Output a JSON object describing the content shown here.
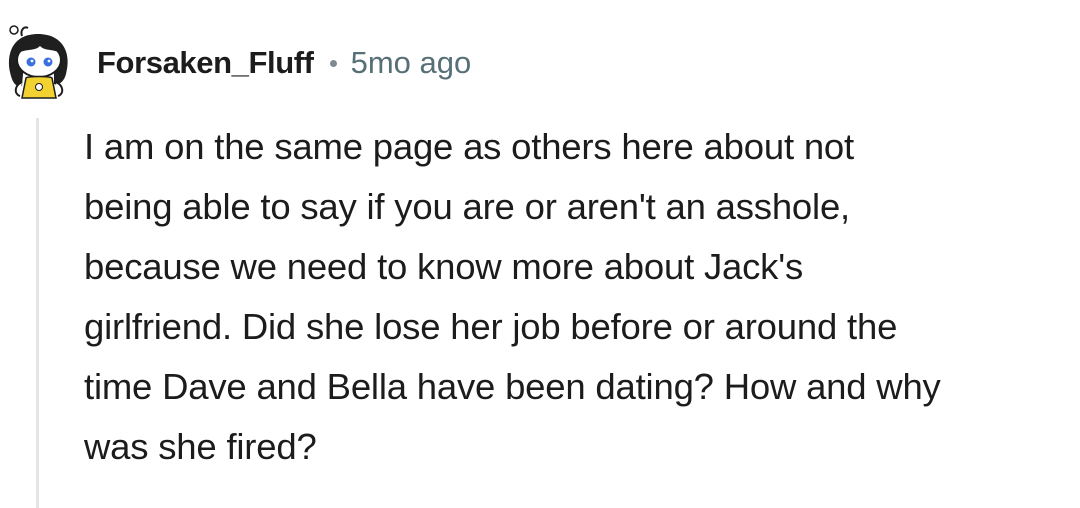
{
  "comment": {
    "username": "Forsaken_Fluff",
    "timestamp": "5mo ago",
    "avatar_icon": "snoo-avatar-icon",
    "body_lines": [
      "I am on the same page as others here about not",
      "being able to say if you are or aren't an asshole,",
      "because we need to know more about Jack's",
      "girlfriend. Did she lose her job before or around the",
      "time Dave and Bella have been dating? How and why",
      "was she fired?"
    ]
  },
  "colors": {
    "text": "#1c1c1c",
    "meta": "#576f76",
    "thread_line": "#e2e5e7",
    "avatar_accent": "#f2d230"
  }
}
